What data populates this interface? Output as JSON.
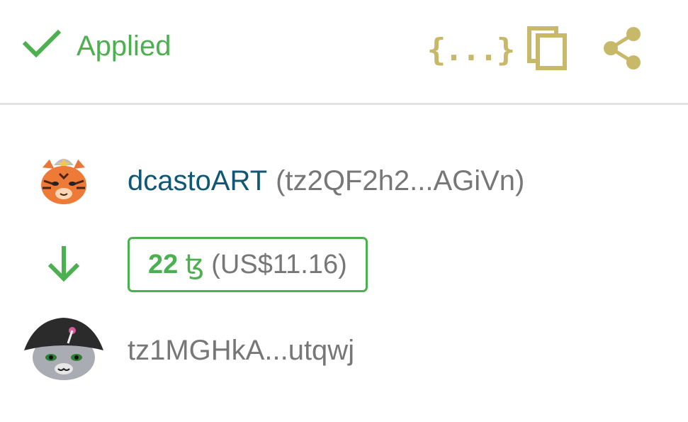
{
  "status": {
    "label": "Applied",
    "icon": "check-icon",
    "color": "#4caf50"
  },
  "actions": {
    "json": {
      "icon": "json-braces-icon",
      "glyph": "{...}"
    },
    "copy": {
      "icon": "copy-icon"
    },
    "share": {
      "icon": "share-icon"
    },
    "color": "#c8b96a"
  },
  "sender": {
    "avatar": "tiger-avatar",
    "name": "dcastoART",
    "address": "(tz2QF2h2...AGiVn)"
  },
  "transfer": {
    "direction_icon": "arrow-down-icon",
    "amount": "22",
    "unit": "ꜩ",
    "fiat": "(US$11.16)"
  },
  "recipient": {
    "avatar": "cat-hat-avatar",
    "address": "tz1MGHkA...utqwj"
  },
  "colors": {
    "accent_green": "#4caf50",
    "link_blue": "#0f5774",
    "muted_gray": "#777777",
    "action_gold": "#c8b96a"
  }
}
